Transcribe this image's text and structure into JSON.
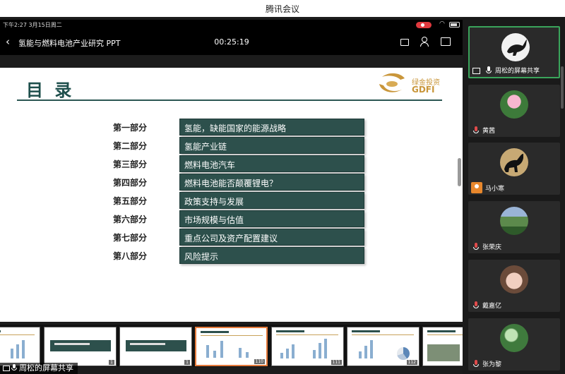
{
  "window": {
    "title": "腾讯会议"
  },
  "statusbar": {
    "time": "下午2:27  3月15日周二"
  },
  "navbar": {
    "back_label": "‹",
    "doc_title": "氢能与燃料电池产业研究 PPT",
    "timer": "00:25:19"
  },
  "slide": {
    "heading": "目 录",
    "logo": {
      "cn": "绿金投资",
      "en": "GDFI",
      "accent": "#c9963a"
    },
    "accent_color": "#2d504c",
    "sections": [
      {
        "part": "第一部分",
        "title": "氢能，缺能国家的能源战略"
      },
      {
        "part": "第二部分",
        "title": "氢能产业链"
      },
      {
        "part": "第三部分",
        "title": "燃料电池汽车"
      },
      {
        "part": "第四部分",
        "title": "燃料电池能否颠覆锂电？"
      },
      {
        "part": "第五部分",
        "title": "政策支持与发展"
      },
      {
        "part": "第六部分",
        "title": "市场规模与估值"
      },
      {
        "part": "第七部分",
        "title": "重点公司及资产配置建议"
      },
      {
        "part": "第八部分",
        "title": "风险提示"
      }
    ]
  },
  "thumbnails": [
    {
      "num": "",
      "kind": "chart"
    },
    {
      "num": "1",
      "kind": "section"
    },
    {
      "num": "1",
      "kind": "section"
    },
    {
      "num": "110",
      "kind": "bars",
      "active": true
    },
    {
      "num": "111",
      "kind": "bars"
    },
    {
      "num": "112",
      "kind": "pie"
    },
    {
      "num": "",
      "kind": "photo"
    }
  ],
  "share_label": "周松的屏幕共享",
  "participants": [
    {
      "name": "周松的屏幕共享",
      "avatar": "horse-sketch-avatar",
      "speaking": true,
      "icon": "share"
    },
    {
      "name": "黄茜",
      "avatar": "lotus-avatar",
      "icon": "mic"
    },
    {
      "name": "马小寒",
      "avatar": "black-horse-avatar",
      "icon": "person"
    },
    {
      "name": "张荣庆",
      "avatar": "landscape-avatar",
      "icon": "mic"
    },
    {
      "name": "戴嘉亿",
      "avatar": "child-avatar",
      "icon": "mic"
    },
    {
      "name": "张为黎",
      "avatar": "plant-avatar",
      "icon": "mic"
    }
  ]
}
